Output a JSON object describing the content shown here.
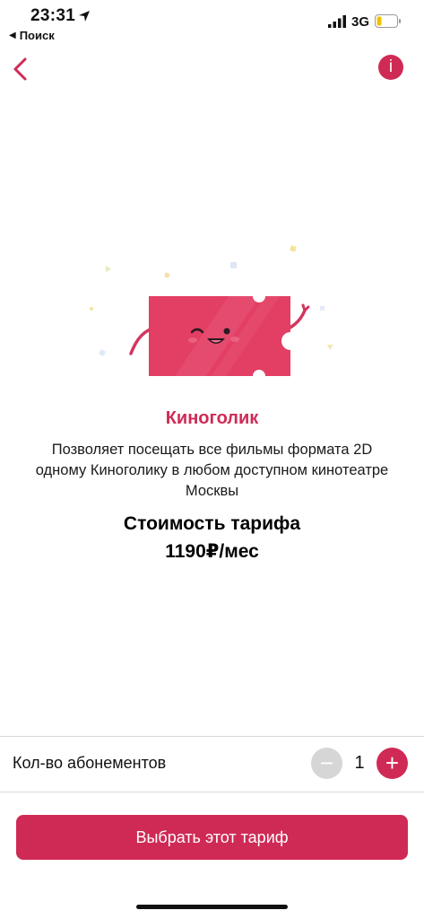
{
  "status_bar": {
    "time": "23:31",
    "back_app_label": "Поиск",
    "network": "3G"
  },
  "nav": {
    "back_icon": "chevron-left-icon",
    "info_label": "i"
  },
  "tariff": {
    "name": "Киноголик",
    "description": "Позволяет посещать все фильмы формата 2D одному Киноголику в любом доступном кинотеатре Москвы",
    "price_label": "Стоимость тарифа",
    "price_value": "1190₽/мес"
  },
  "quantity": {
    "label": "Кол-во абонементов",
    "minus": "−",
    "value": "1",
    "plus": "+"
  },
  "cta": {
    "label": "Выбрать этот тариф"
  },
  "colors": {
    "accent": "#cf2a55",
    "disabled": "#d6d6d6"
  }
}
